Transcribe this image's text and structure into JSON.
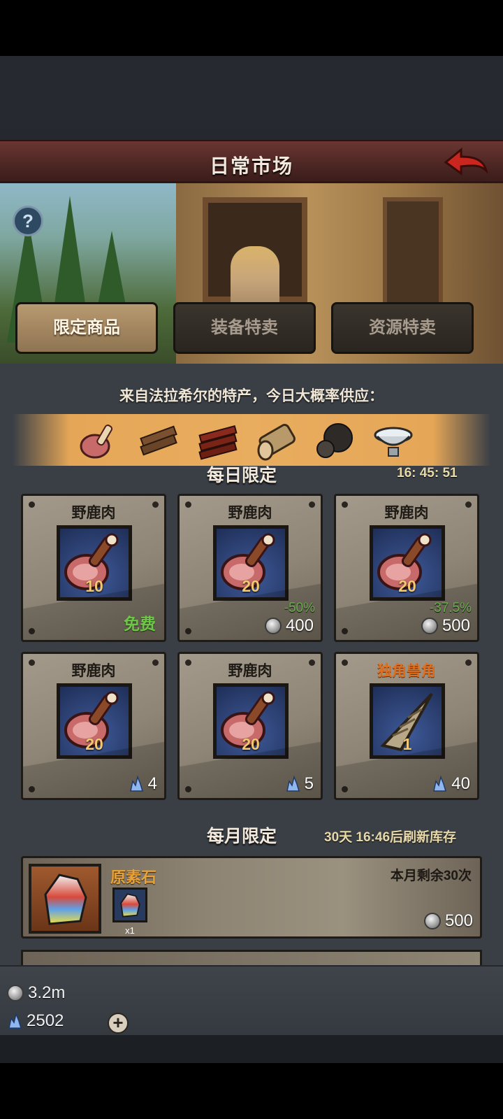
{
  "header": {
    "title": "日常市场"
  },
  "tabs": [
    {
      "label": "限定商品",
      "active": true
    },
    {
      "label": "装备特卖",
      "active": false
    },
    {
      "label": "资源特卖",
      "active": false
    }
  ],
  "specialty": {
    "caption": "来自法拉希尔的特产，今日大概率供应：",
    "items": [
      "meat-icon",
      "planks-icon",
      "lumber-icon",
      "log-icon",
      "truffle-icon",
      "milk-icon"
    ]
  },
  "daily": {
    "title": "每日限定",
    "timer": "16: 45: 51",
    "items": [
      {
        "name": "野鹿肉",
        "qty": "10",
        "free_label": "免费",
        "icon": "meat-icon"
      },
      {
        "name": "野鹿肉",
        "qty": "20",
        "discount": "-50%",
        "price": "400",
        "currency": "coin",
        "icon": "meat-icon"
      },
      {
        "name": "野鹿肉",
        "qty": "20",
        "discount": "-37.5%",
        "price": "500",
        "currency": "coin",
        "icon": "meat-icon"
      },
      {
        "name": "野鹿肉",
        "qty": "20",
        "price": "4",
        "currency": "gem",
        "icon": "meat-icon"
      },
      {
        "name": "野鹿肉",
        "qty": "20",
        "price": "5",
        "currency": "gem",
        "icon": "meat-icon"
      },
      {
        "name": "独角兽角",
        "qty": "1",
        "price": "40",
        "currency": "gem",
        "icon": "unicorn-horn-icon"
      }
    ]
  },
  "monthly": {
    "title": "每月限定",
    "timer": "30天 16:46后刷新库存",
    "items": [
      {
        "name": "原素石",
        "remaining": "本月剩余30次",
        "mini_qty": "x1",
        "price": "500",
        "currency": "coin",
        "icon": "element-stone-icon"
      }
    ]
  },
  "currency": {
    "coins": "3.2m",
    "gems": "2502"
  },
  "colors": {
    "accent_orange": "#e5a657",
    "title_bar": "#4c2623",
    "discount_green": "#7fd35a",
    "free_green": "#6fc44a"
  }
}
